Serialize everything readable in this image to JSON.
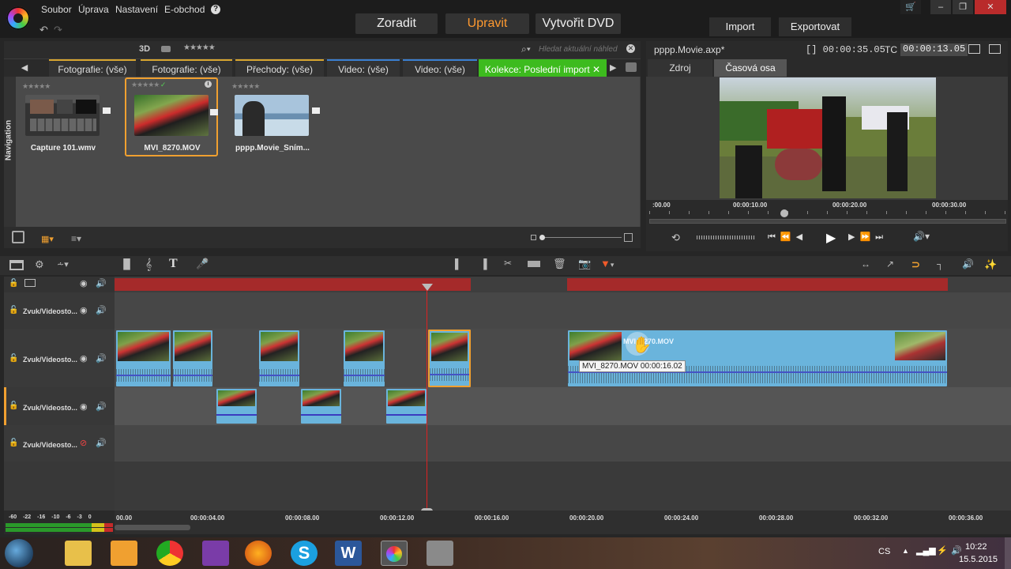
{
  "menu": [
    "Soubor",
    "Úprava",
    "Nastavení",
    "E-obchod"
  ],
  "help_icon": "?",
  "modes": {
    "organize": "Zoradit",
    "edit": "Upravit",
    "create_dvd": "Vytvořit DVD"
  },
  "top_buttons": {
    "import": "Import",
    "export": "Exportovat"
  },
  "library": {
    "mode_3d": "3D",
    "search_placeholder": "Hledat aktuální náhled",
    "tabs": [
      "Fotografie: (vše)",
      "Fotografie: (vše)",
      "Přechody: (vše)",
      "Video: (vše)",
      "Video: (vše)",
      "Kolekce: Poslední import"
    ],
    "nav_label": "Navigation",
    "items": [
      {
        "label": "Capture 101.wmv"
      },
      {
        "label": "MVI_8270.MOV"
      },
      {
        "label": "pppp.Movie_Sním..."
      }
    ]
  },
  "preview": {
    "title": "pppp.Movie.axp*",
    "duration": "[] 00:00:35.05",
    "tc_label": "TC",
    "tc_value": "00:00:13.05",
    "tabs": [
      "Zdroj",
      "Časová osa"
    ],
    "ruler": [
      ":00.00",
      "00:00:10.00",
      "00:00:20.00",
      "00:00:30.00"
    ]
  },
  "timeline": {
    "tracks": [
      "Zvuk/Videosto...",
      "Zvuk/Videosto...",
      "Zvuk/Videosto...",
      "Zvuk/Videosto..."
    ],
    "clip_label": "MVI_8270.MOV",
    "tooltip": "MVI_8270.MOV  00:00:16.02",
    "scale": [
      "00.00",
      "00:00:04.00",
      "00:00:08.00",
      "00:00:12.00",
      "00:00:16.00",
      "00:00:20.00",
      "00:00:24.00",
      "00:00:28.00",
      "00:00:32.00",
      "00:00:36.00"
    ],
    "vu_labels": [
      "-60",
      "-22",
      "-16",
      "-10",
      "-6",
      "-3",
      "0"
    ]
  },
  "taskbar": {
    "lang": "CS",
    "time": "10:22",
    "date": "15.5.2015"
  },
  "colors": {
    "accent_orange": "#f0a030",
    "upravit": "#ff9a30",
    "collection_tab": "#3dbb1e",
    "playhead": "#dd2222"
  }
}
